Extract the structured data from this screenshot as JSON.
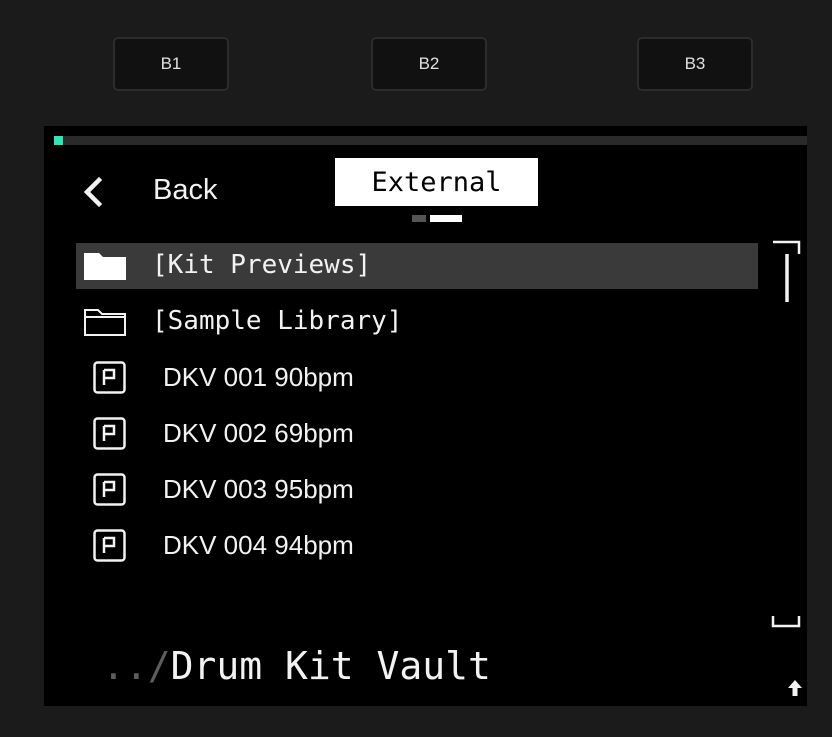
{
  "hardware_buttons": [
    {
      "label": "B1"
    },
    {
      "label": "B2"
    },
    {
      "label": "B3"
    }
  ],
  "screen": {
    "progress": 0.01,
    "accent_color": "#2ee6b0",
    "back_label": "Back",
    "back_icon": "chevron-left-icon",
    "location_tab": "External",
    "page_indicator": {
      "pages": 2,
      "current": 2
    },
    "items": [
      {
        "label": "[Kit Previews]",
        "type": "folder",
        "icon": "folder-filled-icon",
        "selected": true
      },
      {
        "label": "[Sample Library]",
        "type": "folder",
        "icon": "folder-outline-icon",
        "selected": false
      },
      {
        "label": "DKV 001 90bpm",
        "type": "preset",
        "icon": "preset-icon",
        "selected": false
      },
      {
        "label": "DKV 002 69bpm",
        "type": "preset",
        "icon": "preset-icon",
        "selected": false
      },
      {
        "label": "DKV 003 95bpm",
        "type": "preset",
        "icon": "preset-icon",
        "selected": false
      },
      {
        "label": "DKV 004 94bpm",
        "type": "preset",
        "icon": "preset-icon",
        "selected": false
      }
    ],
    "path_prefix": "../",
    "path_name": "Drum Kit Vault",
    "up_icon": "arrow-up-icon"
  }
}
